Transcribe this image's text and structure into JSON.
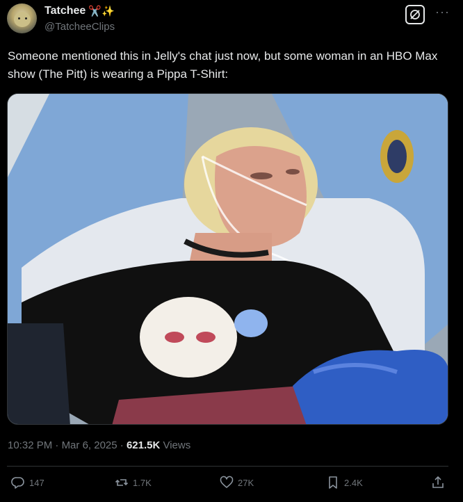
{
  "author": {
    "display_name": "Tatchee",
    "emoji": "✂️✨",
    "handle": "@TatcheeClips"
  },
  "tweet": {
    "text": "Someone mentioned this in Jelly's chat just now, but some woman in an HBO Max show (The Pitt) is wearing a Pippa T-Shirt:"
  },
  "meta": {
    "time": "10:32 PM",
    "separator1": " · ",
    "date": "Mar 6, 2025",
    "separator2": " · ",
    "views_count": "621.5K",
    "views_label": " Views"
  },
  "actions": {
    "replies": "147",
    "reposts": "1.7K",
    "likes": "27K",
    "bookmarks": "2.4K"
  },
  "icons": {
    "grok": "grok-icon",
    "more": "more-icon",
    "reply": "reply-icon",
    "repost": "repost-icon",
    "like": "heart-icon",
    "bookmark": "bookmark-icon",
    "share": "share-icon"
  },
  "colors": {
    "background": "#000000",
    "text_primary": "#e7e9ea",
    "text_secondary": "#71767b",
    "divider": "#2f3336"
  }
}
